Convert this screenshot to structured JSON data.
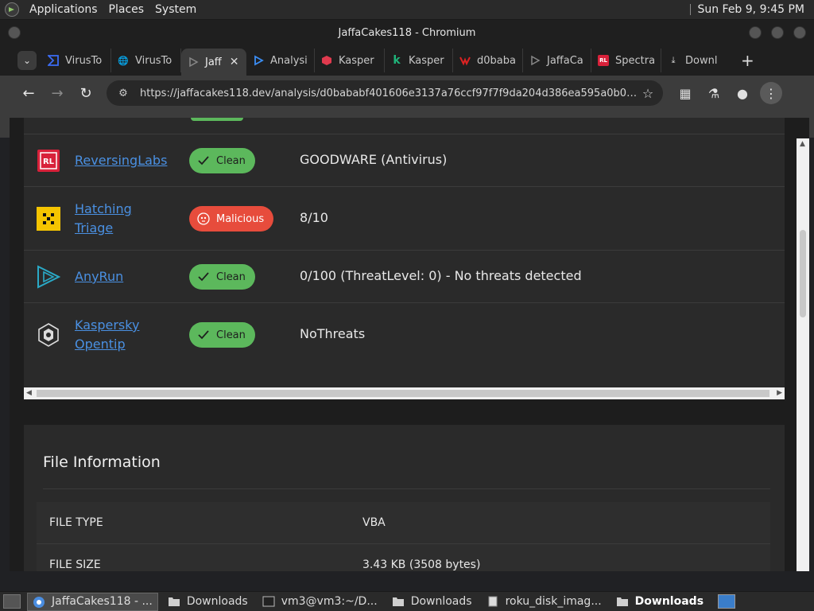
{
  "top_panel": {
    "menus": [
      "Applications",
      "Places",
      "System"
    ],
    "clock": "Sun Feb 9,  9:45 PM"
  },
  "window": {
    "title": "JaffaCakes118 - Chromium"
  },
  "tabs": [
    {
      "label": "VirusTo",
      "icon": "virustotal-icon",
      "active": false
    },
    {
      "label": "VirusTo",
      "icon": "globe-icon",
      "active": false
    },
    {
      "label": "Jaff",
      "icon": "jaffacakes-icon",
      "active": true
    },
    {
      "label": "Analysi",
      "icon": "anyrun-icon",
      "active": false
    },
    {
      "label": "Kasper",
      "icon": "kaspersky-red-icon",
      "active": false
    },
    {
      "label": "Kasper",
      "icon": "kaspersky-k-icon",
      "active": false
    },
    {
      "label": "d0baba",
      "icon": "hybrid-icon",
      "active": false
    },
    {
      "label": "JaffaCa",
      "icon": "jaffacakes-icon",
      "active": false
    },
    {
      "label": "Spectra",
      "icon": "reversinglabs-icon",
      "active": false
    },
    {
      "label": "Downl",
      "icon": "download-icon",
      "active": false
    }
  ],
  "toolbar": {
    "url": "https://jaffacakes118.dev/analysis/d0bababf401606e3137a76ccf97f7f9da204d386ea595a0b0abeec..."
  },
  "results": [
    {
      "vendor": "ReversingLabs",
      "status": "Clean",
      "result": "GOODWARE (Antivirus)",
      "logo": "reversinglabs-logo"
    },
    {
      "vendor": "Hatching Triage",
      "status": "Malicious",
      "result": "8/10",
      "logo": "hatching-triage-logo"
    },
    {
      "vendor": "AnyRun",
      "status": "Clean",
      "result": "0/100 (ThreatLevel: 0) - No threats detected",
      "logo": "anyrun-logo"
    },
    {
      "vendor": "Kaspersky Opentip",
      "status": "Clean",
      "result": "NoThreats",
      "logo": "kaspersky-logo"
    }
  ],
  "file_info": {
    "heading": "File Information",
    "rows": [
      {
        "key": "FILE TYPE",
        "value": "VBA"
      },
      {
        "key": "FILE SIZE",
        "value": "3.43 KB (3508 bytes)"
      }
    ]
  },
  "taskbar": {
    "items": [
      {
        "label": "JaffaCakes118 - ...",
        "icon": "chromium-icon",
        "active": true,
        "bold": false
      },
      {
        "label": "Downloads",
        "icon": "folder-icon",
        "active": false,
        "bold": false
      },
      {
        "label": "vm3@vm3:~/D...",
        "icon": "terminal-icon",
        "active": false,
        "bold": false
      },
      {
        "label": "Downloads",
        "icon": "folder-icon",
        "active": false,
        "bold": false
      },
      {
        "label": "roku_disk_imag...",
        "icon": "file-icon",
        "active": false,
        "bold": false
      },
      {
        "label": "Downloads",
        "icon": "folder-icon",
        "active": false,
        "bold": true
      }
    ]
  },
  "colors": {
    "clean": "#5cb85c",
    "malicious": "#e74c3c",
    "link": "#4a90e2"
  }
}
